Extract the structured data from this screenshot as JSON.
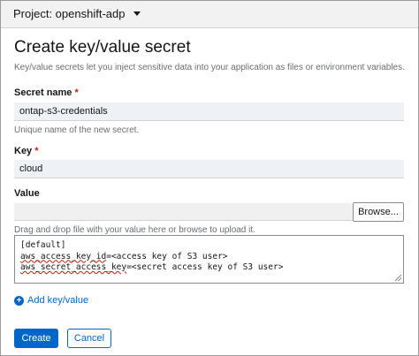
{
  "header": {
    "project_label": "Project: openshift-adp"
  },
  "form": {
    "title": "Create key/value secret",
    "subtitle": "Key/value secrets let you inject sensitive data into your application as files or environment variables.",
    "secret_name": {
      "label": "Secret name",
      "required_mark": "*",
      "value": "ontap-s3-credentials",
      "helper": "Unique name of the new secret."
    },
    "key": {
      "label": "Key",
      "required_mark": "*",
      "value": "cloud"
    },
    "value_field": {
      "label": "Value",
      "browse_label": "Browse...",
      "helper": "Drag and drop file with your value here or browse to upload it.",
      "content_lines": [
        "[default]",
        "aws_access_key_id=<access key of S3 user>",
        "aws_secret_access_key=<secret access key of S3 user>"
      ],
      "line2_misspelled": "aws_access_key_id",
      "line2_rest": "=<access key of S3 user>",
      "line3_misspelled": "aws_secret_access_key",
      "line3_rest": "=<secret access key of S3 user>"
    },
    "add_link": "Add key/value",
    "actions": {
      "create": "Create",
      "cancel": "Cancel"
    }
  },
  "colors": {
    "primary": "#0066cc",
    "required": "#c9190b",
    "input_bg": "#eef1f6"
  }
}
